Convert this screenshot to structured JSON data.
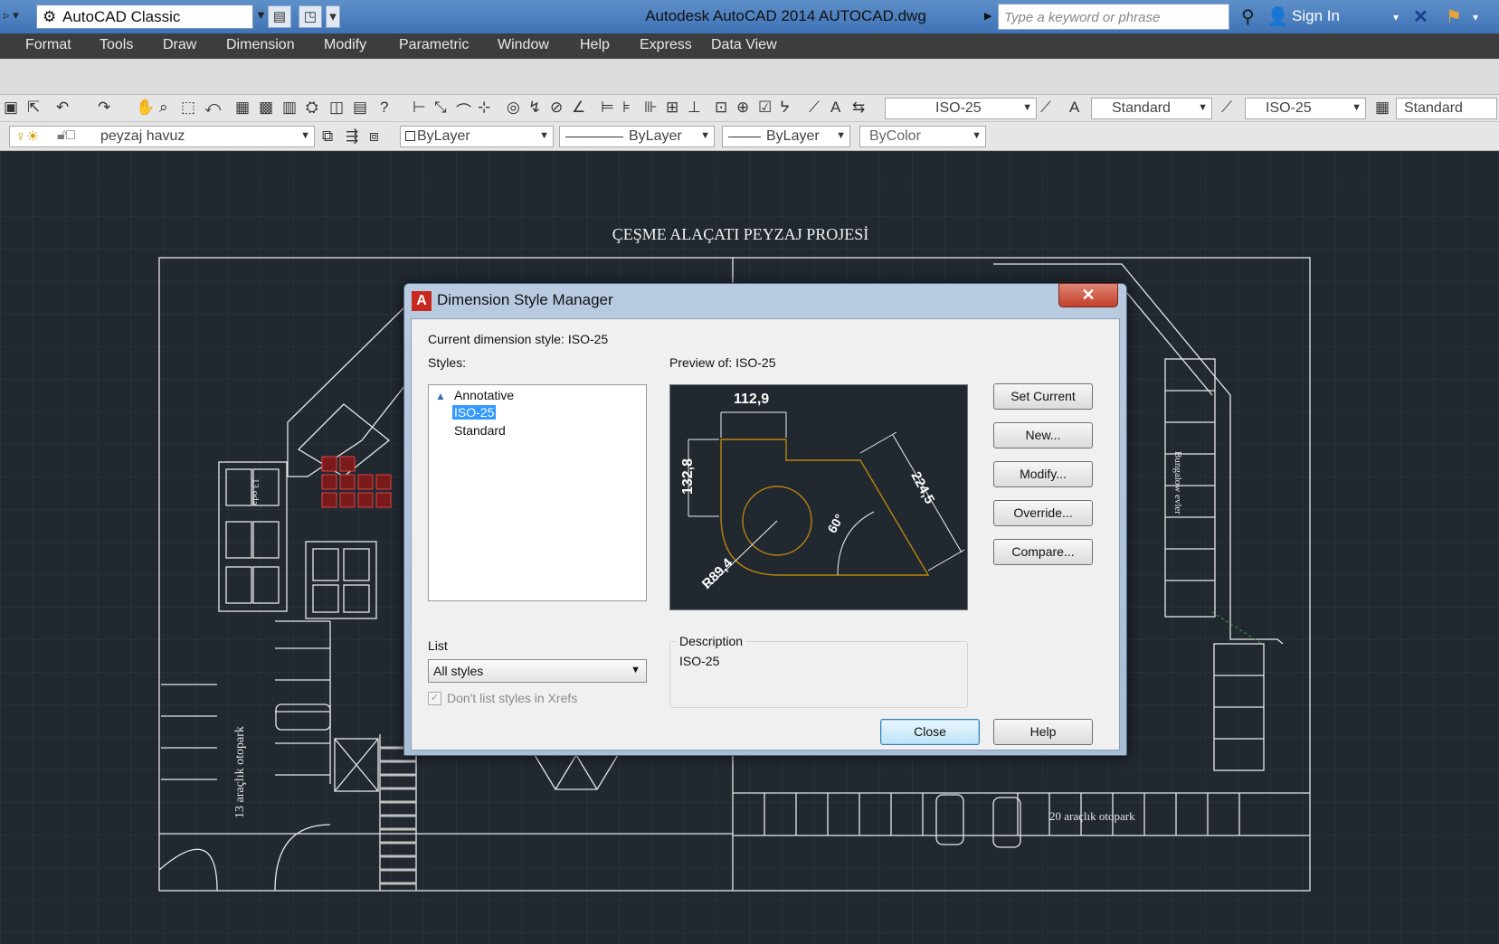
{
  "titlebar": {
    "workspace": "AutoCAD Classic",
    "window_title": "Autodesk AutoCAD 2014    AUTOCAD.dwg",
    "search_placeholder": "Type a keyword or phrase",
    "sign_in": "Sign In"
  },
  "menu": [
    "Format",
    "Tools",
    "Draw",
    "Dimension",
    "Modify",
    "Parametric",
    "Window",
    "Help",
    "Express",
    "Data View"
  ],
  "styles_toolbar": {
    "dim_style": "ISO-25",
    "text_style": "Standard",
    "multileader_style": "ISO-25",
    "table_style": "Standard"
  },
  "layers_toolbar": {
    "layer": "peyzaj havuz",
    "color": "ByLayer",
    "linetype": "ByLayer",
    "lineweight": "ByLayer",
    "plotstyle": "ByColor"
  },
  "drawing": {
    "title": "ÇEŞME ALAÇATI PEYZAJ PROJESİ",
    "parking_left": "13 araçlık otopark",
    "parking_bottom": "20 araçlık otopark",
    "bungalow_label": "Bungalow evler",
    "room_label": "13 oda"
  },
  "dialog": {
    "title": "Dimension Style Manager",
    "current_style": "Current dimension style: ISO-25",
    "styles_label": "Styles:",
    "styles": [
      "Annotative",
      "ISO-25",
      "Standard"
    ],
    "selected_style": "ISO-25",
    "preview_label": "Preview of: ISO-25",
    "list_label": "List",
    "list_value": "All styles",
    "xref_checkbox": "Don't list styles in Xrefs",
    "description_label": "Description",
    "description_value": "ISO-25",
    "buttons": {
      "set_current": "Set Current",
      "new": "New...",
      "modify": "Modify...",
      "override": "Override...",
      "compare": "Compare...",
      "close": "Close",
      "help": "Help"
    },
    "preview_values": {
      "top": "112,9",
      "left": "132,8",
      "diag": "224,5",
      "angle": "60°",
      "radius": "R89,4"
    }
  },
  "colors": {
    "canvas": "#212830",
    "selection": "#3399ff",
    "titlebar": "#4a80c0",
    "preview_geometry": "#b8860b"
  }
}
